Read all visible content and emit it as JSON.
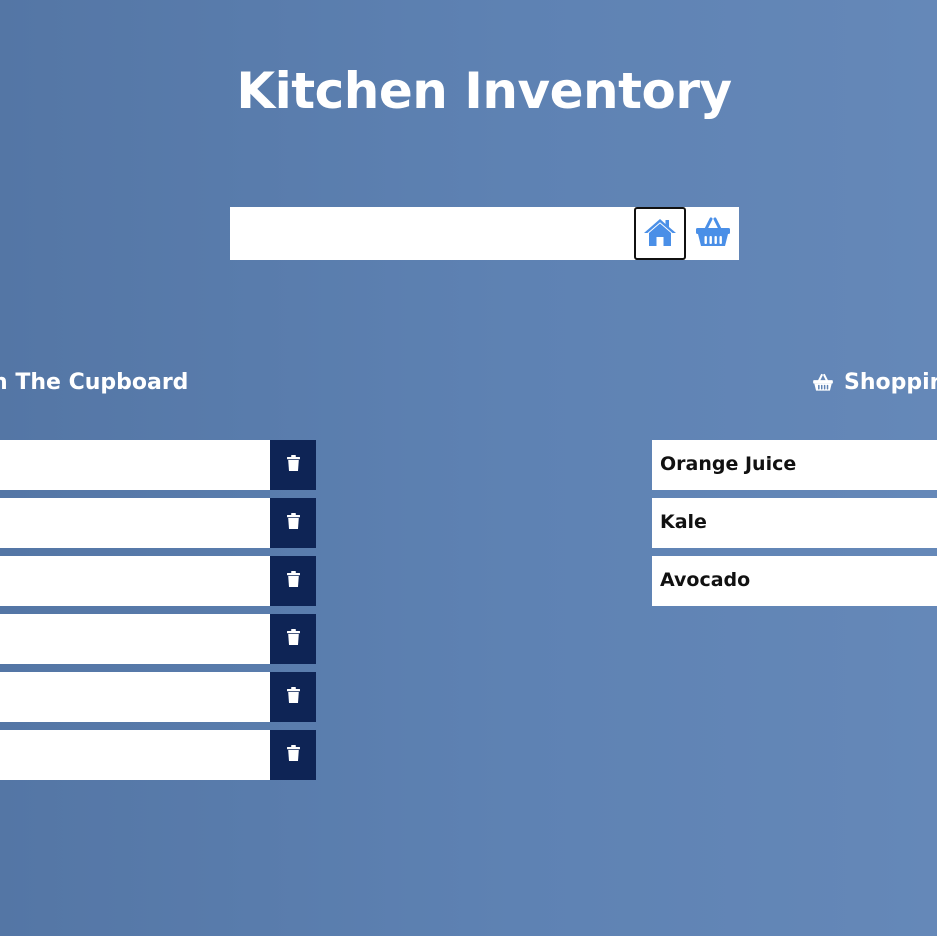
{
  "header": {
    "title": "Kitchen Inventory"
  },
  "input": {
    "value": "",
    "placeholder": ""
  },
  "buttons": {
    "home_icon": "home-icon",
    "basket_icon": "basket-icon",
    "accent_color": "#4a8fe7"
  },
  "cupboard": {
    "heading": "n The Cupboard",
    "items": [
      {
        "label": ""
      },
      {
        "label": ""
      },
      {
        "label": ""
      },
      {
        "label": ""
      },
      {
        "label": ""
      },
      {
        "label": ""
      }
    ],
    "delete_icon": "trash-icon",
    "delete_color": "#0e2455"
  },
  "shopping": {
    "heading": "Shoppin",
    "icon": "basket-icon",
    "items": [
      {
        "label": "Orange Juice"
      },
      {
        "label": "Kale"
      },
      {
        "label": "Avocado"
      }
    ]
  }
}
